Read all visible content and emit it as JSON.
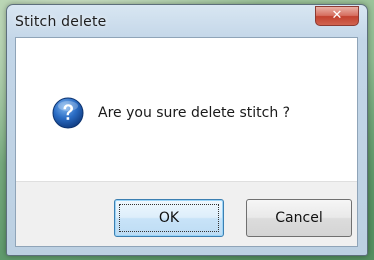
{
  "dialog": {
    "title": "Stitch delete",
    "message": "Are you sure delete stitch ?",
    "close_glyph": "✕",
    "icon": "question-icon"
  },
  "buttons": {
    "ok_label": "OK",
    "cancel_label": "Cancel"
  },
  "colors": {
    "close_button": "#c7503e",
    "question_icon": "#1f5fb0",
    "default_button_border": "#3c7fb1"
  }
}
